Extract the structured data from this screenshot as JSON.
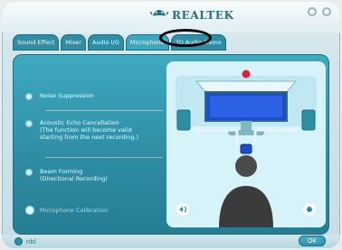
{
  "brand": {
    "name": "REALTEK"
  },
  "tabs": [
    {
      "label": "Sound Effect"
    },
    {
      "label": "Mixer"
    },
    {
      "label": "Audio I/O"
    },
    {
      "label": "Microphone"
    },
    {
      "label": "3D Audio Demo"
    }
  ],
  "active_tab_index": 3,
  "options": {
    "noise_suppression": {
      "label": "Noise Suppression"
    },
    "aec": {
      "label": "Acoustic Echo Cancellation",
      "note": "(The function will become valid starting from the next recording.)"
    },
    "beam_forming": {
      "label": "Beam Forming",
      "sub": "(Directional Recording)"
    },
    "calibration": {
      "label": "Microphone Calibration"
    }
  },
  "icons": {
    "logo": "crab-logo-icon",
    "minimize": "minimize-icon",
    "close": "close-icon",
    "calibration": "microphone-calibration-icon",
    "speaker": "speaker-icon",
    "settings": "settings-icon",
    "info": "info-icon"
  },
  "colors": {
    "accent": "#2f8ea4",
    "accent_light": "#3aa8bf",
    "background": "#c7dde6",
    "brand_text": "#2d6c7d",
    "highlight_ellipse": "#000000"
  },
  "footer": {
    "left_label": "nbl",
    "ok_label": "OK"
  }
}
